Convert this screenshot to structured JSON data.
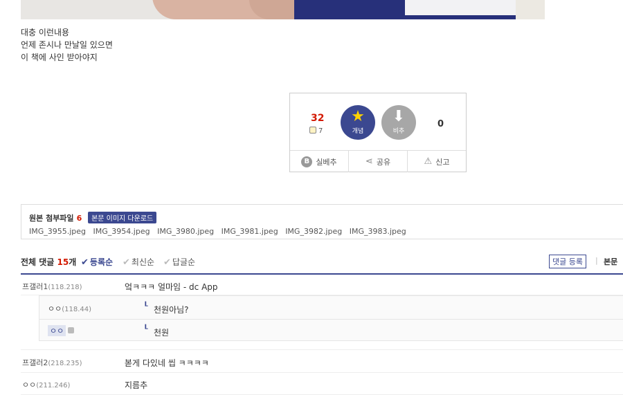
{
  "post": {
    "body_lines": [
      "대충 이런내용",
      "언제 존시나 만날일 있으면",
      "이 책에 사인 받아야지"
    ]
  },
  "vote": {
    "up_count": "32",
    "fix_count": "7",
    "up_label": "개념",
    "down_label": "비추",
    "down_count": "0",
    "actions": [
      "실베추",
      "공유",
      "신고"
    ]
  },
  "attachments": {
    "title": "원본 첨부파일",
    "count": "6",
    "download_label": "본문 이미지 다운로드",
    "files": [
      "IMG_3955.jpeg",
      "IMG_3954.jpeg",
      "IMG_3980.jpeg",
      "IMG_3981.jpeg",
      "IMG_3982.jpeg",
      "IMG_3983.jpeg"
    ]
  },
  "comments": {
    "total_prefix": "전체 댓글",
    "total_count": "15",
    "total_suffix": "개",
    "sort_options": [
      "등록순",
      "최신순",
      "답글순"
    ],
    "register_label": "댓글 등록",
    "body_label": "본문",
    "items": [
      {
        "nick": "프갤러1",
        "ip": "(118.218)",
        "memo": "엌ㅋㅋㅋ 얼마임 - dc App"
      },
      {
        "nick": "ㅇㅇ",
        "ip": "(118.44)",
        "memo": "천원아님?"
      },
      {
        "nick": "ㅇㅇ",
        "ip": "",
        "memo": "천원"
      },
      {
        "nick": "프갤러2",
        "ip": "(218.235)",
        "memo": "볻게 다있네 씹 ㅋㅋㅋㅋ"
      },
      {
        "nick": "ㅇㅇ",
        "ip": "(211.246)",
        "memo": "지름추"
      }
    ]
  }
}
